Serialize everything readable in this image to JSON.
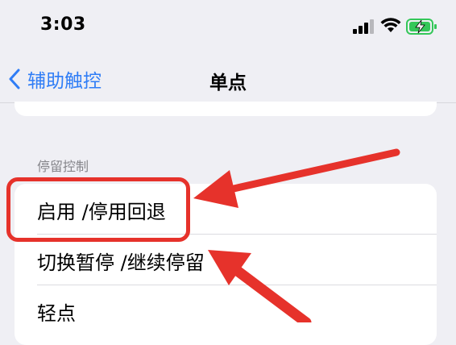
{
  "status_bar": {
    "time": "3:03"
  },
  "nav": {
    "back_label": "辅助触控",
    "title": "单点"
  },
  "section": {
    "header": "停留控制",
    "items": [
      {
        "label": "启用 /停用回退"
      },
      {
        "label": "切换暂停 /继续停留"
      },
      {
        "label": "轻点"
      }
    ]
  },
  "annotation": {
    "highlight_color": "#e6322b"
  },
  "colors": {
    "accent": "#2f7df6",
    "background": "#efeff4",
    "battery": "#34c759"
  }
}
